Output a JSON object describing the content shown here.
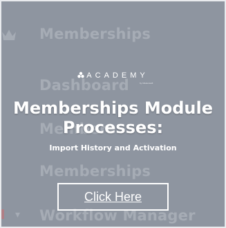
{
  "background_menu": {
    "items": [
      {
        "label": "Memberships"
      },
      {
        "label": "Dashboard"
      },
      {
        "label": "Members"
      },
      {
        "label": "Memberships"
      },
      {
        "label": "Workflow Manager"
      }
    ]
  },
  "overlay": {
    "brand": "ACADEMY",
    "brand_tagline": "by Infusionsoft",
    "title_line1": "Memberships Module",
    "title_line2": "Processes:",
    "subtitle": "Import History and Activation",
    "cta_label": "Click Here"
  },
  "colors": {
    "overlay": "#8e95a0",
    "faded_text": "#a6acb5",
    "foreground": "#ffffff"
  },
  "icons": {
    "background_top": "crown-icon",
    "brand": "academy-logo-icon"
  }
}
